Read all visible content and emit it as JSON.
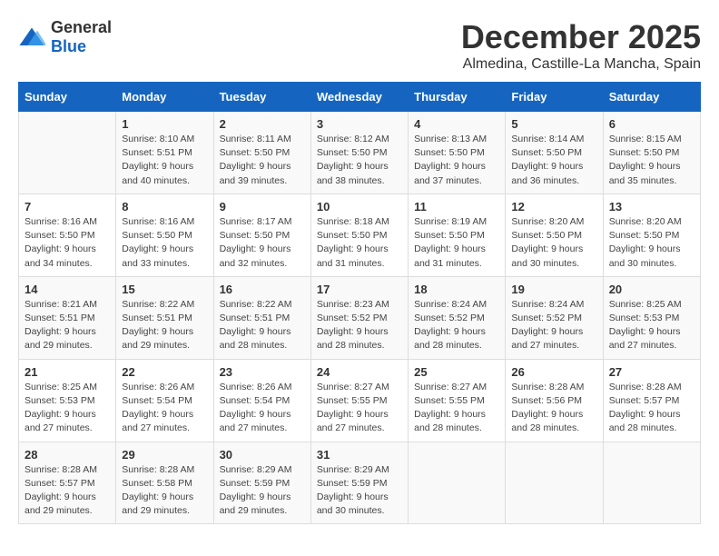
{
  "header": {
    "logo_general": "General",
    "logo_blue": "Blue",
    "main_title": "December 2025",
    "subtitle": "Almedina, Castille-La Mancha, Spain"
  },
  "calendar": {
    "days_of_week": [
      "Sunday",
      "Monday",
      "Tuesday",
      "Wednesday",
      "Thursday",
      "Friday",
      "Saturday"
    ],
    "weeks": [
      [
        {
          "day": "",
          "info": ""
        },
        {
          "day": "1",
          "info": "Sunrise: 8:10 AM\nSunset: 5:51 PM\nDaylight: 9 hours\nand 40 minutes."
        },
        {
          "day": "2",
          "info": "Sunrise: 8:11 AM\nSunset: 5:50 PM\nDaylight: 9 hours\nand 39 minutes."
        },
        {
          "day": "3",
          "info": "Sunrise: 8:12 AM\nSunset: 5:50 PM\nDaylight: 9 hours\nand 38 minutes."
        },
        {
          "day": "4",
          "info": "Sunrise: 8:13 AM\nSunset: 5:50 PM\nDaylight: 9 hours\nand 37 minutes."
        },
        {
          "day": "5",
          "info": "Sunrise: 8:14 AM\nSunset: 5:50 PM\nDaylight: 9 hours\nand 36 minutes."
        },
        {
          "day": "6",
          "info": "Sunrise: 8:15 AM\nSunset: 5:50 PM\nDaylight: 9 hours\nand 35 minutes."
        }
      ],
      [
        {
          "day": "7",
          "info": "Sunrise: 8:16 AM\nSunset: 5:50 PM\nDaylight: 9 hours\nand 34 minutes."
        },
        {
          "day": "8",
          "info": "Sunrise: 8:16 AM\nSunset: 5:50 PM\nDaylight: 9 hours\nand 33 minutes."
        },
        {
          "day": "9",
          "info": "Sunrise: 8:17 AM\nSunset: 5:50 PM\nDaylight: 9 hours\nand 32 minutes."
        },
        {
          "day": "10",
          "info": "Sunrise: 8:18 AM\nSunset: 5:50 PM\nDaylight: 9 hours\nand 31 minutes."
        },
        {
          "day": "11",
          "info": "Sunrise: 8:19 AM\nSunset: 5:50 PM\nDaylight: 9 hours\nand 31 minutes."
        },
        {
          "day": "12",
          "info": "Sunrise: 8:20 AM\nSunset: 5:50 PM\nDaylight: 9 hours\nand 30 minutes."
        },
        {
          "day": "13",
          "info": "Sunrise: 8:20 AM\nSunset: 5:50 PM\nDaylight: 9 hours\nand 30 minutes."
        }
      ],
      [
        {
          "day": "14",
          "info": "Sunrise: 8:21 AM\nSunset: 5:51 PM\nDaylight: 9 hours\nand 29 minutes."
        },
        {
          "day": "15",
          "info": "Sunrise: 8:22 AM\nSunset: 5:51 PM\nDaylight: 9 hours\nand 29 minutes."
        },
        {
          "day": "16",
          "info": "Sunrise: 8:22 AM\nSunset: 5:51 PM\nDaylight: 9 hours\nand 28 minutes."
        },
        {
          "day": "17",
          "info": "Sunrise: 8:23 AM\nSunset: 5:52 PM\nDaylight: 9 hours\nand 28 minutes."
        },
        {
          "day": "18",
          "info": "Sunrise: 8:24 AM\nSunset: 5:52 PM\nDaylight: 9 hours\nand 28 minutes."
        },
        {
          "day": "19",
          "info": "Sunrise: 8:24 AM\nSunset: 5:52 PM\nDaylight: 9 hours\nand 27 minutes."
        },
        {
          "day": "20",
          "info": "Sunrise: 8:25 AM\nSunset: 5:53 PM\nDaylight: 9 hours\nand 27 minutes."
        }
      ],
      [
        {
          "day": "21",
          "info": "Sunrise: 8:25 AM\nSunset: 5:53 PM\nDaylight: 9 hours\nand 27 minutes."
        },
        {
          "day": "22",
          "info": "Sunrise: 8:26 AM\nSunset: 5:54 PM\nDaylight: 9 hours\nand 27 minutes."
        },
        {
          "day": "23",
          "info": "Sunrise: 8:26 AM\nSunset: 5:54 PM\nDaylight: 9 hours\nand 27 minutes."
        },
        {
          "day": "24",
          "info": "Sunrise: 8:27 AM\nSunset: 5:55 PM\nDaylight: 9 hours\nand 27 minutes."
        },
        {
          "day": "25",
          "info": "Sunrise: 8:27 AM\nSunset: 5:55 PM\nDaylight: 9 hours\nand 28 minutes."
        },
        {
          "day": "26",
          "info": "Sunrise: 8:28 AM\nSunset: 5:56 PM\nDaylight: 9 hours\nand 28 minutes."
        },
        {
          "day": "27",
          "info": "Sunrise: 8:28 AM\nSunset: 5:57 PM\nDaylight: 9 hours\nand 28 minutes."
        }
      ],
      [
        {
          "day": "28",
          "info": "Sunrise: 8:28 AM\nSunset: 5:57 PM\nDaylight: 9 hours\nand 29 minutes."
        },
        {
          "day": "29",
          "info": "Sunrise: 8:28 AM\nSunset: 5:58 PM\nDaylight: 9 hours\nand 29 minutes."
        },
        {
          "day": "30",
          "info": "Sunrise: 8:29 AM\nSunset: 5:59 PM\nDaylight: 9 hours\nand 29 minutes."
        },
        {
          "day": "31",
          "info": "Sunrise: 8:29 AM\nSunset: 5:59 PM\nDaylight: 9 hours\nand 30 minutes."
        },
        {
          "day": "",
          "info": ""
        },
        {
          "day": "",
          "info": ""
        },
        {
          "day": "",
          "info": ""
        }
      ]
    ]
  }
}
